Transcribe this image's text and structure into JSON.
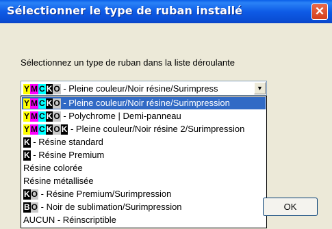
{
  "window": {
    "title": "Sélectionner le type de ruban installé",
    "close_icon": "close-icon"
  },
  "prompt": "Sélectionnez un type de ruban dans la liste déroulante",
  "select": {
    "chips": [
      "Y",
      "M",
      "C",
      "K",
      "O"
    ],
    "value_text": " - Pleine couleur/Noir résine/Surimpress",
    "arrow_icon": "chevron-down-icon"
  },
  "options": [
    {
      "chips": [
        "Y",
        "M",
        "C",
        "K",
        "O"
      ],
      "text": " - Pleine couleur/Noir résine/Surimpression",
      "selected": true
    },
    {
      "chips": [
        "Y",
        "M",
        "C",
        "K",
        "O"
      ],
      "text": " - Polychrome | Demi-panneau"
    },
    {
      "chips": [
        "Y",
        "M",
        "C",
        "K",
        "O",
        "K"
      ],
      "text": " - Pleine couleur/Noir résine 2/Surimpression"
    },
    {
      "chips": [
        "K"
      ],
      "text": " - Résine standard"
    },
    {
      "chips": [
        "K"
      ],
      "text": " - Résine Premium"
    },
    {
      "chips": [],
      "text": "Résine colorée"
    },
    {
      "chips": [],
      "text": "Résine métallisée"
    },
    {
      "chips": [
        "K",
        "O"
      ],
      "text": " - Résine Premium/Surimpression"
    },
    {
      "chips": [
        "B",
        "O"
      ],
      "text": " - Noir de sublimation/Surimpression"
    },
    {
      "chips": [],
      "text": "AUCUN - Réinscriptible"
    }
  ],
  "ok_button": "OK",
  "colors": {
    "titlebar": "#0a4fd6",
    "selection": "#316ac5",
    "Y": "#ffff00",
    "M": "#ff00ff",
    "C": "#00ffff",
    "K": "#000000",
    "O": "#c8c8c8"
  }
}
